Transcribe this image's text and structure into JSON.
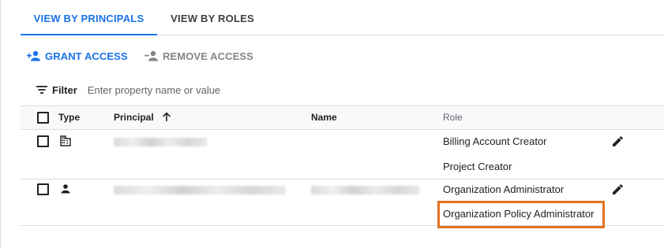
{
  "tabs": [
    {
      "label": "VIEW BY PRINCIPALS",
      "active": true
    },
    {
      "label": "VIEW BY ROLES",
      "active": false
    }
  ],
  "actions": {
    "grant_label": "GRANT ACCESS",
    "remove_label": "REMOVE ACCESS"
  },
  "filter": {
    "label": "Filter",
    "placeholder": "Enter property name or value"
  },
  "table": {
    "columns": {
      "type": "Type",
      "principal": "Principal",
      "name": "Name",
      "role": "Role"
    },
    "sort_icon": "arrow-upward-icon",
    "rows": [
      {
        "type_icon": "domain-icon",
        "roles": [
          "Billing Account Creator",
          "Project Creator"
        ]
      },
      {
        "type_icon": "person-icon",
        "roles": [
          "Organization Administrator",
          "Organization Policy Administrator"
        ],
        "highlighted_role": "Organization Policy Administrator"
      }
    ]
  },
  "colors": {
    "accent": "#1a73e8",
    "highlight": "#e37222",
    "muted": "#80868b"
  }
}
